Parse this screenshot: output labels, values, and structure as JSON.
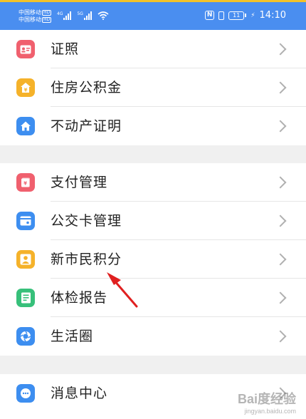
{
  "status_bar": {
    "carrier1": "中国移动",
    "carrier2": "中国移动",
    "hd": "HD",
    "net_tag1": "4G",
    "net_tag2": "5G",
    "battery": "11",
    "time": "14:10"
  },
  "groups": [
    {
      "items": [
        {
          "label": "证照",
          "icon": "id-card-icon",
          "color": "#f0606e"
        },
        {
          "label": "住房公积金",
          "icon": "house-fund-icon",
          "color": "#f5b22a"
        },
        {
          "label": "不动产证明",
          "icon": "home-icon",
          "color": "#3d8ef0"
        }
      ]
    },
    {
      "items": [
        {
          "label": "支付管理",
          "icon": "payment-icon",
          "color": "#f0606e"
        },
        {
          "label": "公交卡管理",
          "icon": "bus-card-icon",
          "color": "#3d8ef0"
        },
        {
          "label": "新市民积分",
          "icon": "person-icon",
          "color": "#f5b22a"
        },
        {
          "label": "体检报告",
          "icon": "report-icon",
          "color": "#37c07a"
        },
        {
          "label": "生活圈",
          "icon": "aperture-icon",
          "color": "#3d8ef0"
        }
      ]
    },
    {
      "items": [
        {
          "label": "消息中心",
          "icon": "message-icon",
          "color": "#3d8ef0"
        }
      ]
    }
  ],
  "watermark": {
    "text": "Bai度经验",
    "url": "jingyan.baidu.com"
  }
}
